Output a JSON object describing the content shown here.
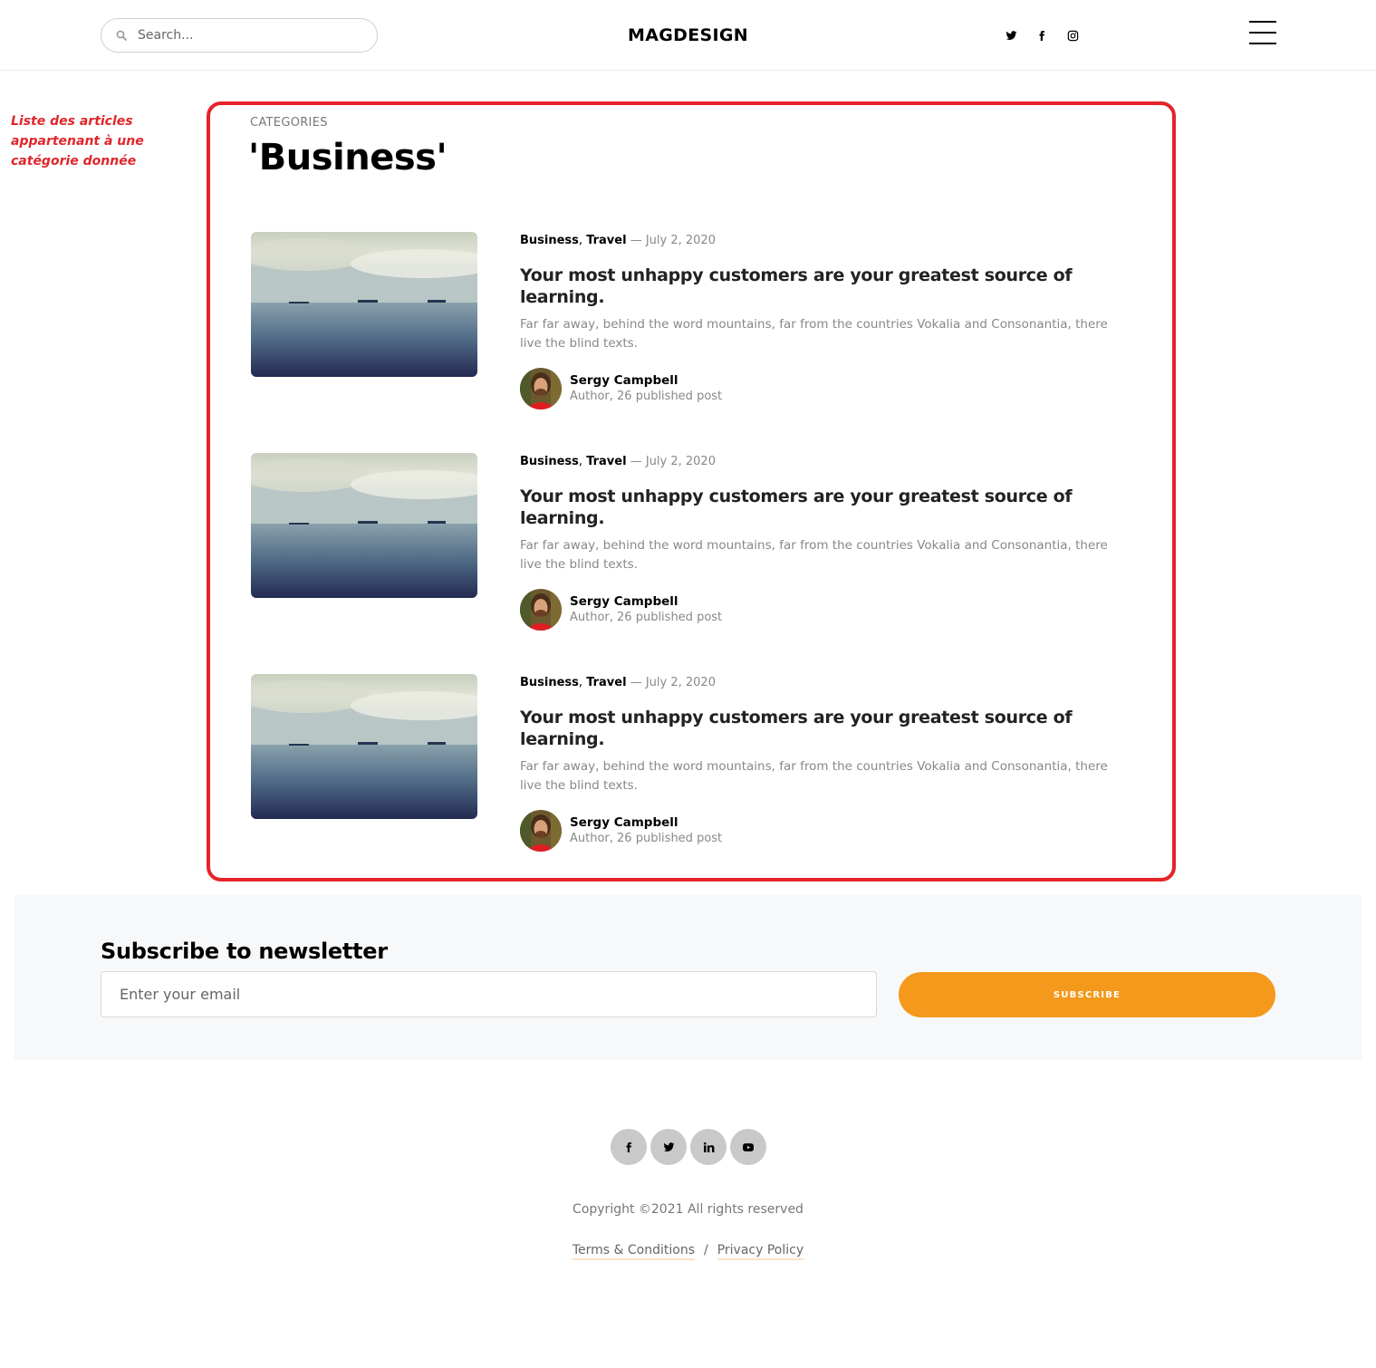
{
  "header": {
    "search_placeholder": "Search...",
    "brand": "MAGDESIGN",
    "social_icons": [
      "twitter-icon",
      "facebook-icon",
      "instagram-icon"
    ],
    "menu_icon": "hamburger-menu-icon"
  },
  "annotation": {
    "text": "Liste des articles appartenant à une catégorie donnée",
    "color": "#e0262b"
  },
  "category": {
    "label": "CATEGORIES",
    "title": "'Business'"
  },
  "articles": [
    {
      "tag1": "Business",
      "tag_sep": ",",
      "tag2": "Travel",
      "date": "— July 2, 2020",
      "title": "Your most unhappy customers are your greatest source of learning.",
      "excerpt": "Far far away, behind the word mountains, far from the countries Vokalia and Consonantia, there live the blind texts.",
      "author_name": "Sergy Campbell",
      "author_role": "Author, 26 published post"
    },
    {
      "tag1": "Business",
      "tag_sep": ",",
      "tag2": "Travel",
      "date": "— July 2, 2020",
      "title": "Your most unhappy customers are your greatest source of learning.",
      "excerpt": "Far far away, behind the word mountains, far from the countries Vokalia and Consonantia, there live the blind texts.",
      "author_name": "Sergy Campbell",
      "author_role": "Author, 26 published post"
    },
    {
      "tag1": "Business",
      "tag_sep": ",",
      "tag2": "Travel",
      "date": "— July 2, 2020",
      "title": "Your most unhappy customers are your greatest source of learning.",
      "excerpt": "Far far away, behind the word mountains, far from the countries Vokalia and Consonantia, there live the blind texts.",
      "author_name": "Sergy Campbell",
      "author_role": "Author, 26 published post"
    }
  ],
  "newsletter": {
    "title": "Subscribe to newsletter",
    "email_placeholder": "Enter your email",
    "button_label": "SUBSCRIBE",
    "button_color": "#f4991c"
  },
  "footer": {
    "social_icons": [
      "facebook-icon",
      "twitter-icon",
      "linkedin-icon",
      "youtube-icon"
    ],
    "copyright": "Copyright ©2021 All rights reserved",
    "terms": "Terms & Conditions",
    "separator": "/",
    "privacy": "Privacy Policy"
  },
  "colors": {
    "highlight_frame": "#e52329",
    "accent": "#f4991c"
  }
}
